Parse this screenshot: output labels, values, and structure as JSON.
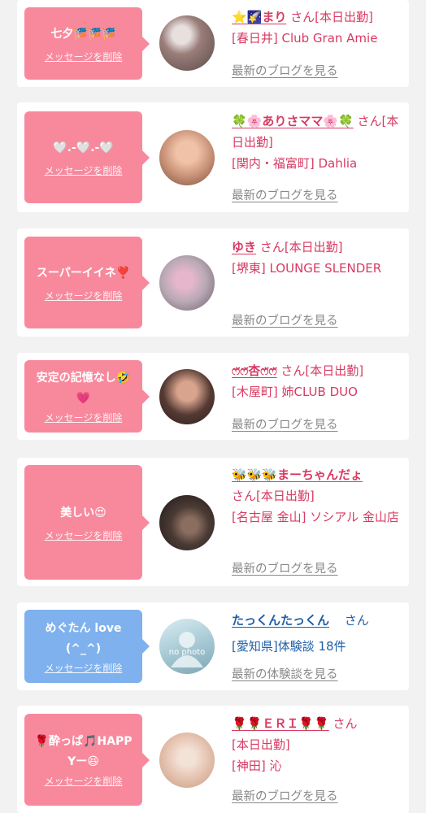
{
  "messages": [
    {
      "bubble_text": "七夕🎏🎏🎏",
      "delete_label": "メッセージを削除",
      "bubble_color": "#f8899d",
      "name": "⭐🌠まり",
      "honorific": "さん",
      "status": "[本日出勤]",
      "place": "[春日井] Club Gran Amie",
      "link": "最新のブログを見る",
      "avatar_colors": [
        "#9a7e7a",
        "#e8e0df",
        "#5a4a48"
      ]
    },
    {
      "bubble_text": "🤍.-🤍.-🤍",
      "delete_label": "メッセージを削除",
      "bubble_color": "#f8899d",
      "name": "🍀🌸ありさママ🌸🍀",
      "honorific": "さん",
      "status": "[本日出勤]",
      "place": "[関内・福富町] Dahlia",
      "link": "最新のブログを見る",
      "avatar_colors": [
        "#f0c2a8",
        "#c99378",
        "#7b4f3d"
      ]
    },
    {
      "bubble_text": "スーパーイイネ❣️",
      "delete_label": "メッセージを削除",
      "bubble_color": "#f8899d",
      "name": "ゆき",
      "honorific": "さん",
      "status": "[本日出勤]",
      "place": "[堺東] LOUNGE SLENDER",
      "link": "最新のブログを見る",
      "avatar_colors": [
        "#b9aab5",
        "#e6b6cc",
        "#6e5a6b"
      ]
    },
    {
      "bubble_text": "安定の記憶なし🤣💗",
      "delete_label": "メッセージを削除",
      "bubble_color": "#f8899d",
      "name": "ෆ̈ෆ̈杏ෆ̈ෆ̈",
      "honorific": "さん",
      "status": "[本日出勤]",
      "place": "[木屋町] 姉CLUB DUO",
      "link": "最新のブログを見る",
      "avatar_colors": [
        "#d9a48e",
        "#553a33",
        "#2b1f1c"
      ]
    },
    {
      "bubble_text": "美しい😍",
      "delete_label": "メッセージを削除",
      "bubble_color": "#f8899d",
      "name": "🐝🐝🐝まーちゃんだょ",
      "honorific": "さん",
      "status": "[本日出勤]",
      "place": "[名古屋 金山] ソシアル 金山店",
      "link": "最新のブログを見る",
      "avatar_colors": [
        "#4a3a34",
        "#1e1816",
        "#8b6e60"
      ]
    },
    {
      "bubble_text": "めぐたん love(^_^)",
      "delete_label": "メッセージを削除",
      "bubble_color": "#7fb1ee",
      "name": "たっくんたっくん",
      "honorific": "さん",
      "status": "",
      "place": "[愛知県]体験談 18件",
      "link": "最新の体験談を見る",
      "avatar_colors": [
        "#cfe4ea",
        "#9fc3cf",
        "#7fa6b4"
      ],
      "avatar_text": "no photo"
    },
    {
      "bubble_text": "🌹酔っぱ🎵HAPPYー😆",
      "delete_label": "メッセージを削除",
      "bubble_color": "#f8899d",
      "name": "🌹🌹ＥＲＩ🌹🌹",
      "honorific": "さん",
      "status": "[本日出勤]",
      "place": "[神田] 沁",
      "link": "最新のブログを見る",
      "avatar_colors": [
        "#e9c9b8",
        "#c79a7c",
        "#f3e2d8"
      ]
    }
  ]
}
